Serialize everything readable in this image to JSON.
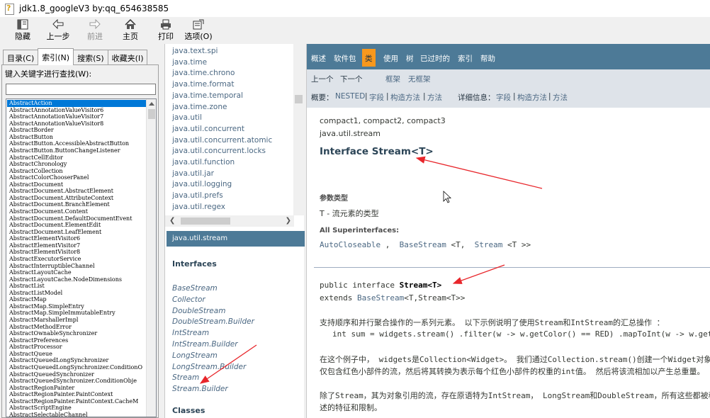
{
  "window": {
    "title": "jdk1.8_googleV3 by:qq_654638585"
  },
  "toolbar": {
    "buttons": [
      {
        "label": "隐藏",
        "icon": "hide-pane-icon"
      },
      {
        "label": "上一步",
        "icon": "back-arrow-icon"
      },
      {
        "label": "前进",
        "icon": "forward-arrow-icon"
      },
      {
        "label": "主页",
        "icon": "home-icon"
      },
      {
        "label": "打印",
        "icon": "print-icon"
      },
      {
        "label": "选项(O)",
        "icon": "options-icon"
      }
    ]
  },
  "left": {
    "tabs": [
      "目录(C)",
      "索引(N)",
      "搜索(S)",
      "收藏夹(I)"
    ],
    "active_tab": "索引(N)",
    "keyword_label": "键入关键字进行查找(W):",
    "keyword_value": "",
    "keywords": [
      "AbstractAction",
      "AbstractAnnotationValueVisitor6",
      "AbstractAnnotationValueVisitor7",
      "AbstractAnnotationValueVisitor8",
      "AbstractBorder",
      "AbstractButton",
      "AbstractButton.AccessibleAbstractButton",
      "AbstractButton.ButtonChangeListener",
      "AbstractCellEditor",
      "AbstractChronology",
      "AbstractCollection",
      "AbstractColorChooserPanel",
      "AbstractDocument",
      "AbstractDocument.AbstractElement",
      "AbstractDocument.AttributeContext",
      "AbstractDocument.BranchElement",
      "AbstractDocument.Content",
      "AbstractDocument.DefaultDocumentEvent",
      "AbstractDocument.ElementEdit",
      "AbstractDocument.LeafElement",
      "AbstractElementVisitor6",
      "AbstractElementVisitor7",
      "AbstractElementVisitor8",
      "AbstractExecutorService",
      "AbstractInterruptibleChannel",
      "AbstractLayoutCache",
      "AbstractLayoutCache.NodeDimensions",
      "AbstractList",
      "AbstractListModel",
      "AbstractMap",
      "AbstractMap.SimpleEntry",
      "AbstractMap.SimpleImmutableEntry",
      "AbstractMarshallerImpl",
      "AbstractMethodError",
      "AbstractOwnableSynchronizer",
      "AbstractPreferences",
      "AbstractProcessor",
      "AbstractQueue",
      "AbstractQueuedLongSynchronizer",
      "AbstractQueuedLongSynchronizer.ConditionO",
      "AbstractQueuedSynchronizer",
      "AbstractQueuedSynchronizer.ConditionObje",
      "AbstractRegionPainter",
      "AbstractRegionPainter.PaintContext",
      "AbstractRegionPainter.PaintContext.CacheM",
      "AbstractScriptEngine",
      "AbstractSelectableChannel"
    ]
  },
  "middle": {
    "packages": [
      "java.text.spi",
      "java.time",
      "java.time.chrono",
      "java.time.format",
      "java.time.temporal",
      "java.time.zone",
      "java.util",
      "java.util.concurrent",
      "java.util.concurrent.atomic",
      "java.util.concurrent.locks",
      "java.util.function",
      "java.util.jar",
      "java.util.logging",
      "java.util.prefs",
      "java.util.regex"
    ],
    "package_header": "java.util.stream",
    "interfaces_title": "Interfaces",
    "interfaces": [
      "BaseStream",
      "Collector",
      "DoubleStream",
      "DoubleStream.Builder",
      "IntStream",
      "IntStream.Builder",
      "LongStream",
      "LongStream.Builder",
      "Stream",
      "Stream.Builder"
    ],
    "classes_title": "Classes"
  },
  "right": {
    "nav": [
      "概述",
      "软件包",
      "类",
      "使用",
      "树",
      "已过时的",
      "索引",
      "帮助"
    ],
    "nav_active": "类",
    "subnav1": {
      "prev": "上一个",
      "next": "下一个",
      "frames": "框架",
      "noframes": "无框架"
    },
    "subnav2": {
      "summary_label": "概要：",
      "nested": "NESTED",
      "sep": "|",
      "field": "字段",
      "constructor": "构造方法",
      "method": "方法",
      "detail_label": "详细信息：",
      "d_field": "字段",
      "d_constructor": "构造方法",
      "d_method": "方法"
    },
    "profiles": "compact1, compact2, compact3",
    "package_name": "java.util.stream",
    "title": "Interface Stream<T>",
    "type_params_label": "参数类型",
    "type_param": "T - 流元素的类型",
    "superinterfaces_label": "All Superinterfaces:",
    "superinterfaces": {
      "a": "AutoCloseable",
      "sep1": " ,  ",
      "b": "BaseStream",
      "b_args": " <T,  ",
      "c": "Stream",
      "c_args": " <T >>"
    },
    "decl_line1_prefix": "public interface ",
    "decl_line1_name": "Stream<T>",
    "decl_line2_prefix": "extends ",
    "decl_line2_link": "BaseStream",
    "decl_line2_suffix": "<T,Stream<T>>",
    "desc1": "支持顺序和并行聚合操作的一系列元素。 以下示例说明了使用Stream和IntStream的汇总操作 ：",
    "code1": "int sum = widgets.stream() .filter(w -> w.getColor() == RED) .mapToInt(w -> w.getWeight()) .sum();",
    "desc2": "在这个例子中， widgets是Collection<Widget>。 我们通过Collection.stream()创建一个Widget对象流，",
    "desc3": "仅包含红色小部件的流，然后将其转换为表示每个红色小部件的权重的int值。 然后将该流相加以产生总重量。",
    "desc4": "除了Stream，其为对象引用的流，存在原语特为IntStream， LongStream和DoubleStream，所有这些都被称为“流”，并且符合此处",
    "desc5": "述的特征和限制。"
  },
  "colors": {
    "nav_bg": "#4d7a97",
    "nav_active": "#f8981d",
    "subnav_bg": "#dee3e9",
    "link": "#4a6782",
    "annotation_red": "#e8262b",
    "selection": "#0078d7"
  }
}
